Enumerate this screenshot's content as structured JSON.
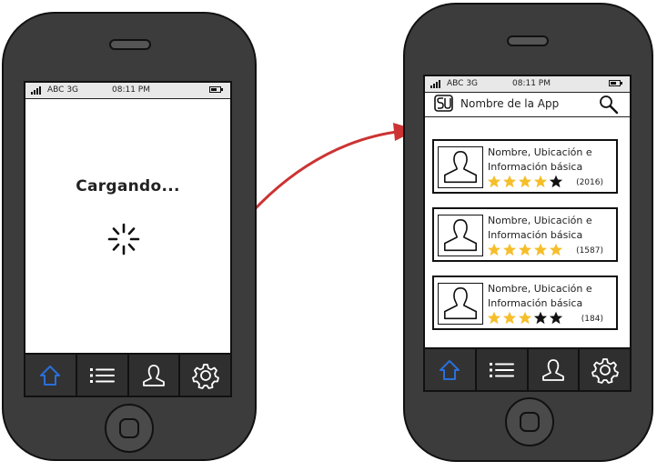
{
  "status_bar": {
    "carrier": "ABC 3G",
    "time": "08:11 PM"
  },
  "loading_screen": {
    "message": "Cargando..."
  },
  "app": {
    "name": "Nombre de la App"
  },
  "listings": [
    {
      "info_line1": "Nombre, Ubicación e",
      "info_line2": "Información básica",
      "rating": 4,
      "max_rating": 5,
      "review_count": "(2016)"
    },
    {
      "info_line1": "Nombre, Ubicación e",
      "info_line2": "Información básica",
      "rating": 5,
      "max_rating": 5,
      "review_count": "(1587)"
    },
    {
      "info_line1": "Nombre, Ubicación e",
      "info_line2": "Información básica",
      "rating": 3,
      "max_rating": 5,
      "review_count": "(184)"
    }
  ],
  "tab_bar": {
    "tabs": [
      "home-icon",
      "list-icon",
      "user-icon",
      "gear-icon"
    ],
    "active_index": 0
  },
  "colors": {
    "active_tab": "#2a6fdb",
    "star_filled": "#f5be2a",
    "star_empty": "#111111",
    "arrow": "#cc3333"
  }
}
